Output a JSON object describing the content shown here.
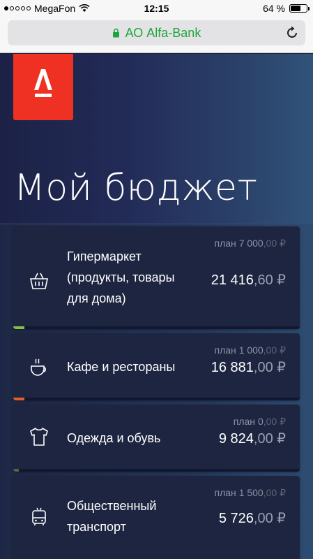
{
  "status": {
    "carrier": "MegaFon",
    "time": "12:15",
    "battery_text": "64 %",
    "battery_level": 0.64
  },
  "browser": {
    "url_title": "АО Alfa-Bank"
  },
  "page": {
    "title": "Мой бюджет",
    "logo_letter": "А"
  },
  "categories": [
    {
      "name_lines": [
        "Гипермаркет",
        "(продукты, товары",
        "для дома)"
      ],
      "plan_label": "план",
      "plan_int": "7 000",
      "plan_cents": ",00 ₽",
      "amount_int": "21 416",
      "amount_cents": ",60 ₽",
      "icon": "basket-icon",
      "bar_color": "#7fc241",
      "bar_level": 0.04
    },
    {
      "name_lines": [
        "Кафе и рестораны"
      ],
      "plan_label": "план",
      "plan_int": "1 000",
      "plan_cents": ",00 ₽",
      "amount_int": "16 881",
      "amount_cents": ",00 ₽",
      "icon": "coffee-cup-icon",
      "bar_color": "#e2602f",
      "bar_level": 0.04
    },
    {
      "name_lines": [
        "Одежда и обувь"
      ],
      "plan_label": "план",
      "plan_int": "0",
      "plan_cents": ",00 ₽",
      "amount_int": "9 824",
      "amount_cents": ",00 ₽",
      "icon": "tshirt-icon",
      "bar_color": "#4a6b3a",
      "bar_level": 0.02
    },
    {
      "name_lines": [
        "Общественный",
        "транспорт"
      ],
      "plan_label": "план",
      "plan_int": "1 500",
      "plan_cents": ",00 ₽",
      "amount_int": "5 726",
      "amount_cents": ",00 ₽",
      "icon": "bus-icon",
      "bar_color": "#e2602f",
      "bar_level": 0.01
    }
  ]
}
